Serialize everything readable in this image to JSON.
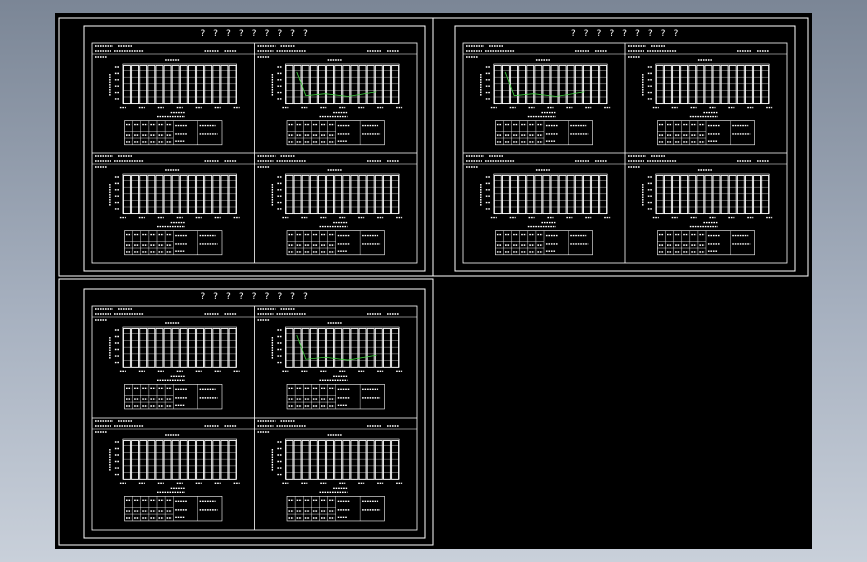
{
  "viewport": {
    "background": "#000000",
    "line_color": "#ffffff",
    "accent_color": "#3fd23f"
  },
  "sheets": [
    {
      "title": "? ? ? ? ? ? ? ? ?"
    },
    {
      "title": "? ? ? ? ? ? ? ? ?"
    },
    {
      "title": "? ? ? ? ? ? ? ? ?"
    }
  ]
}
